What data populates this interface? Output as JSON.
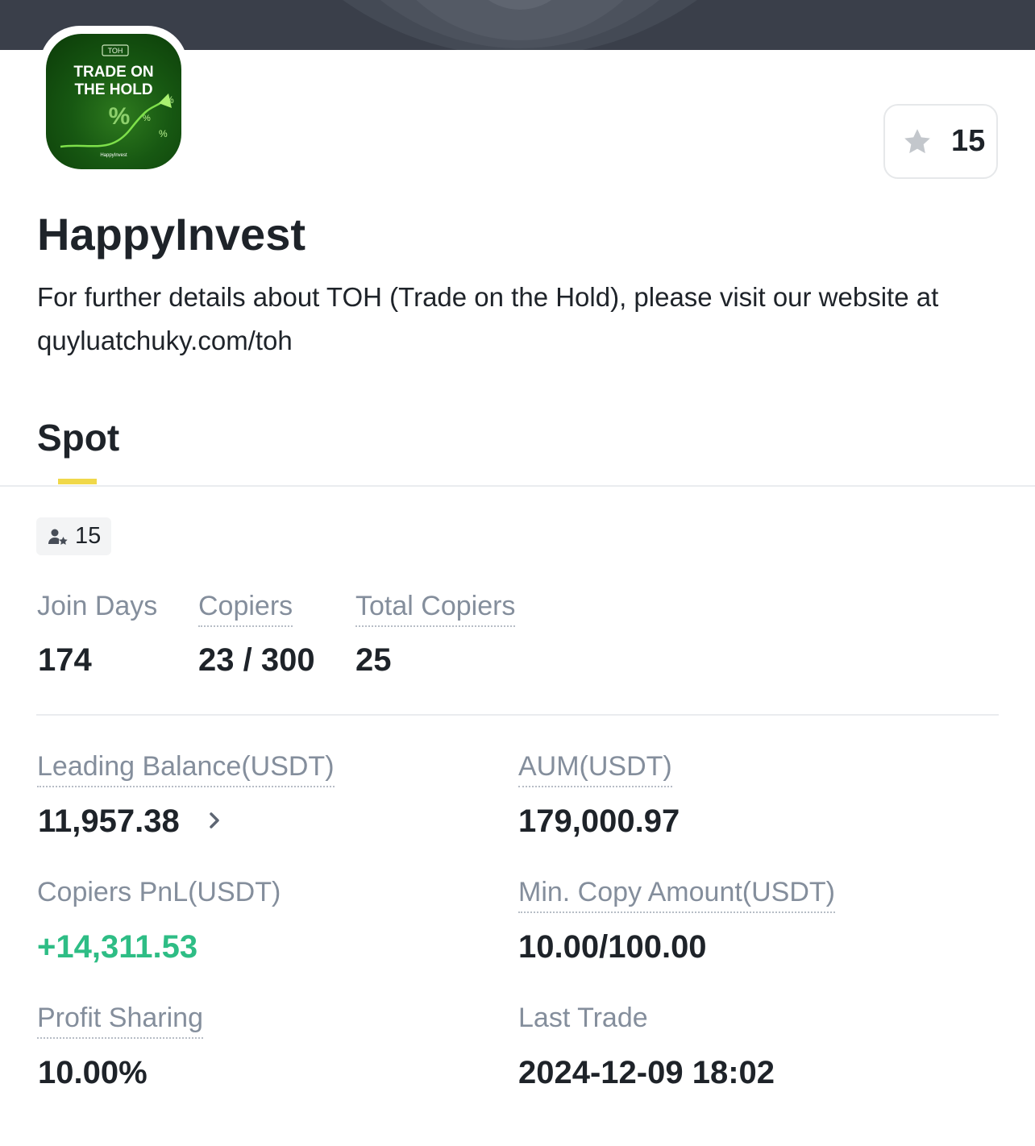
{
  "header": {
    "favorite_count": "15",
    "logo_tag": "TOH",
    "logo_line1": "TRADE ON",
    "logo_line2": "THE HOLD",
    "logo_brand": "HappyInvest"
  },
  "profile": {
    "name": "HappyInvest",
    "description": "For further details about TOH (Trade on the Hold), please visit our website at quyluatchuky.com/toh"
  },
  "tabs": [
    {
      "label": "Spot",
      "active": true
    }
  ],
  "badge": {
    "icon": "user-star-icon",
    "count": "15"
  },
  "stats_top": {
    "join_days": {
      "label": "Join Days",
      "value": "174"
    },
    "copiers": {
      "label": "Copiers",
      "value": "23 / 300"
    },
    "total_copiers": {
      "label": "Total Copiers",
      "value": "25"
    }
  },
  "stats_grid": {
    "leading_balance": {
      "label": "Leading Balance(USDT)",
      "value": "11,957.38"
    },
    "aum": {
      "label": "AUM(USDT)",
      "value": "179,000.97"
    },
    "copiers_pnl": {
      "label": "Copiers PnL(USDT)",
      "value": "+14,311.53"
    },
    "min_copy": {
      "label": "Min. Copy Amount(USDT)",
      "value": "10.00/100.00"
    },
    "profit_sharing": {
      "label": "Profit Sharing",
      "value": "10.00%"
    },
    "last_trade": {
      "label": "Last Trade",
      "value": "2024-12-09 18:02"
    }
  },
  "colors": {
    "positive": "#2ebd85",
    "accent": "#f0d84a",
    "label_gray": "#848e9c",
    "text_dark": "#1e2329"
  }
}
